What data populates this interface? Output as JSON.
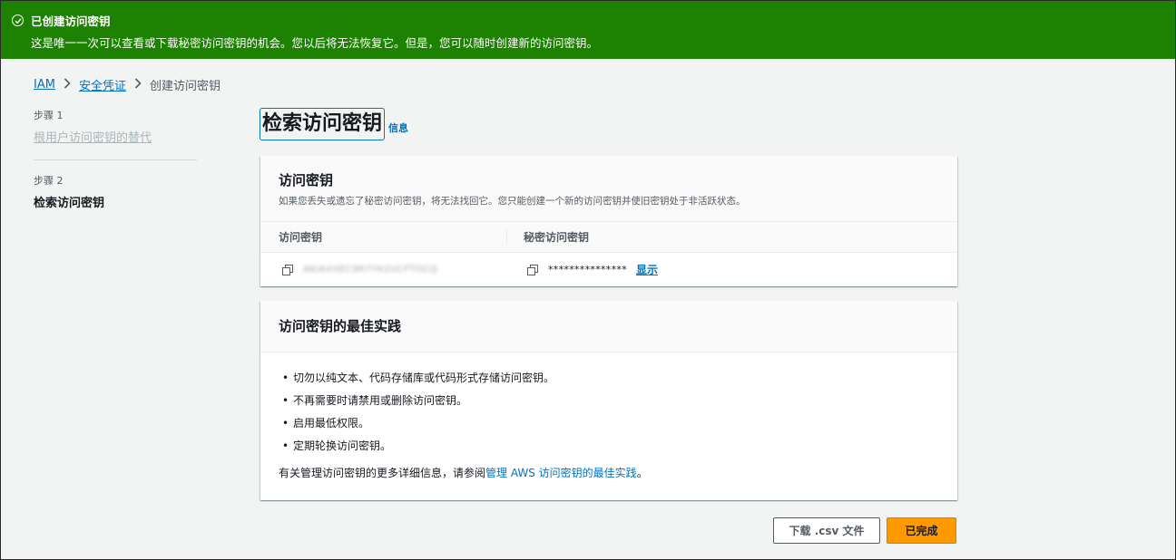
{
  "flash": {
    "title": "已创建访问密钥",
    "message": "这是唯一一次可以查看或下载秘密访问密钥的机会。您以后将无法恢复它。但是，您可以随时创建新的访问密钥。",
    "color": "#1d8102"
  },
  "breadcrumb": {
    "items": [
      "IAM",
      "安全凭证",
      "创建访问密钥"
    ]
  },
  "steps": [
    {
      "label": "步骤 1",
      "name": "根用户访问密钥的替代"
    },
    {
      "label": "步骤 2",
      "name": "检索访问密钥"
    }
  ],
  "page": {
    "title": "检索访问密钥",
    "info_link": "信息"
  },
  "access_key_card": {
    "title": "访问密钥",
    "description": "如果您丢失或遗忘了秘密访问密钥，将无法找回它。您只能创建一个新的访问密钥并使旧密钥处于非活跃状态。",
    "columns": [
      "访问密钥",
      "秘密访问密钥"
    ],
    "access_key_value": "AKIAXXEC9R7YK2UCFTOCQ",
    "secret_key_masked": "***************",
    "show_label": "显示"
  },
  "best_practices": {
    "title": "访问密钥的最佳实践",
    "items": [
      "切勿以纯文本、代码存储库或代码形式存储访问密钥。",
      "不再需要时请禁用或删除访问密钥。",
      "启用最低权限。",
      "定期轮换访问密钥。"
    ],
    "footer_prefix": "有关管理访问密钥的更多详细信息，请参阅",
    "footer_link": "管理 AWS 访问密钥的最佳实践",
    "footer_suffix": "。"
  },
  "actions": {
    "download_label": "下载 .csv 文件",
    "done_label": "已完成",
    "done_color": "#ff9900"
  }
}
